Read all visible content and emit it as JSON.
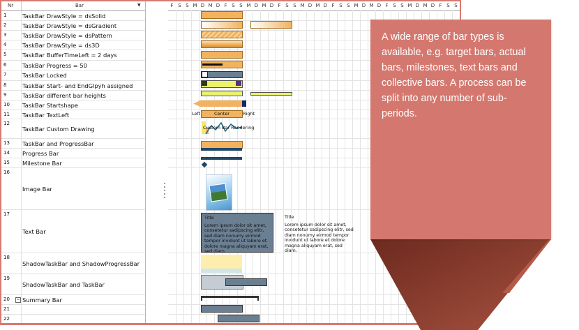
{
  "header": {
    "nr": "Nr",
    "bar": "Bar",
    "sort_arrow": "▼"
  },
  "rows": [
    {
      "n": "1",
      "label": "TaskBar DrawStyle = dsSolid"
    },
    {
      "n": "2",
      "label": "TaskBar DrawStyle = dsGradient"
    },
    {
      "n": "3",
      "label": "TaskBar DrawStyle = dsPattern"
    },
    {
      "n": "4",
      "label": "TaskBar DrawStyle = ds3D"
    },
    {
      "n": "5",
      "label": "TaskBar BufferTimeLeft = 2 days"
    },
    {
      "n": "6",
      "label": "TaskBar Progress = 50"
    },
    {
      "n": "7",
      "label": "TaskBar Locked"
    },
    {
      "n": "8",
      "label": "TaskBar Start- and EndGlpyh assigned"
    },
    {
      "n": "9",
      "label": "TaskBar different bar heights"
    },
    {
      "n": "10",
      "label": "TaskBar Startshape"
    },
    {
      "n": "11",
      "label": "TaskBar TextLeft"
    },
    {
      "n": "12",
      "label": "TaskBar Custom Drawing"
    },
    {
      "n": "13",
      "label": "TaskBar and ProgressBar"
    },
    {
      "n": "14",
      "label": "Progress Bar"
    },
    {
      "n": "15",
      "label": "Milestone Bar"
    },
    {
      "n": "16",
      "label": "Image Bar"
    },
    {
      "n": "17",
      "label": "Text Bar"
    },
    {
      "n": "18",
      "label": "ShadowTaskBar and ShadowProgressBar"
    },
    {
      "n": "19",
      "label": "ShadowTaskBar and TaskBar"
    },
    {
      "n": "20",
      "label": "Summary Bar"
    },
    {
      "n": "21",
      "label": ""
    },
    {
      "n": "22",
      "label": ""
    }
  ],
  "days": [
    "F",
    "S",
    "S",
    "M",
    "D",
    "M",
    "D",
    "F",
    "S",
    "S",
    "M",
    "D",
    "M",
    "D",
    "F",
    "S",
    "S",
    "M",
    "D",
    "M",
    "D",
    "F",
    "S",
    "S",
    "M",
    "D",
    "M",
    "D",
    "F",
    "S",
    "S",
    "M",
    "D",
    "M",
    "D",
    "F",
    "S",
    "S"
  ],
  "bar_texts": {
    "left": "Left",
    "center": "Center",
    "right": "Right",
    "custom": "Custom Bar Rendering",
    "textbar_title": "Title",
    "textbar_body": "Lorem ipsum dolor sit amet, consetetur sadipscing elitr, sed diam nonumy eirmod tempor invidunt ut labore et dolore magna aliquyam erat, sed diam.",
    "textbar2_title": "Title",
    "textbar2_body": "Lorem ipsum dolor sit amet, consetetur sadipscing elitr, sed diam nonumy eirmod tempor invidunt ut labore et dolore magna aliquyam erat, sed diam."
  },
  "callout": {
    "text": "A wide range of bar types is available, e.g. target bars, actual bars, milestones, text bars and collective bars. A process can be split into any number of sub-periods."
  },
  "colors": {
    "frame": "#d77a70",
    "callout": "#d4786f",
    "shadow": "#8a3b2c",
    "bar_orange": "#f2b25e",
    "bar_slate": "#6b7f93",
    "bar_navy": "#1f4765",
    "bar_yellow": "#ecf26a"
  }
}
